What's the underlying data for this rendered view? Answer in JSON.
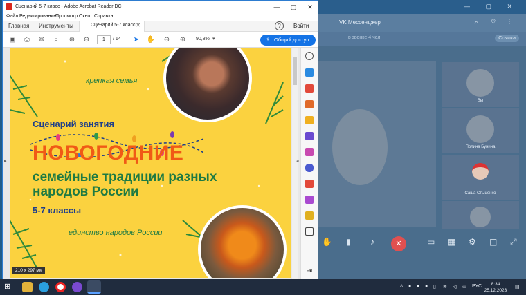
{
  "vk": {
    "title": "VK Мессенджер",
    "subtitle": "в звонке 4 чел.",
    "link_label": "Ссылка",
    "tiles": [
      {
        "name": "Вы"
      },
      {
        "name": "Полина Бунина"
      },
      {
        "name": "Саша Стыценко"
      },
      {
        "name": ""
      }
    ]
  },
  "acrobat": {
    "window_title": "Сценарий 5-7 класс - Adobe Acrobat Reader DC",
    "menu": [
      "Файл",
      "Редактирование",
      "Просмотр",
      "Окно",
      "Справка"
    ],
    "tabs": {
      "home": "Главная",
      "tools": "Инструменты",
      "doc": "Сценарий 5-7 класс"
    },
    "help": "?",
    "signin": "Войти",
    "page_current": "1",
    "page_total": "/ 14",
    "zoom": "90,8%",
    "share_label": "Общий доступ",
    "page_size": "210 x 297 мм"
  },
  "document": {
    "tagline_top": "крепкая семья",
    "heading": "Сценарий занятия",
    "title_big": "НОВОГОДНИЕ",
    "title_rest": "семейные традиции разных народов России",
    "grades": "5-7 классы",
    "tagline_bottom": "единство народов России",
    "colors": {
      "background": "#fbd23f",
      "orange": "#f05a16",
      "green": "#1e7a43",
      "blue": "#1f3f8a"
    }
  },
  "taskbar": {
    "lang": "РУС",
    "time": "8:34",
    "date": "25.12.2023"
  }
}
